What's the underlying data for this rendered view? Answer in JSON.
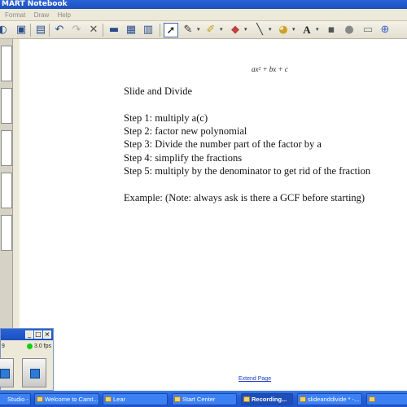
{
  "window": {
    "title": "MART Notebook"
  },
  "menu": {
    "items": [
      "Format",
      "Draw",
      "Help"
    ]
  },
  "page": {
    "formula": "ax² + bx + c",
    "heading": "Slide and Divide",
    "steps": [
      "Step 1: multiply a(c)",
      "Step 2: factor new polynomial",
      "Step 3: Divide the number part of the factor by a",
      "Step 4: simplify the fractions",
      "Step 5: multiply by the denominator to get rid of the fraction"
    ],
    "example": "Example: (Note: always ask is there a GCF before starting)",
    "extend_link": "Extend Page"
  },
  "recorder": {
    "counter": "9",
    "fps": "3.0 fps",
    "status_color": "#11d011"
  },
  "taskbar": {
    "items": [
      "Studio - ...",
      "Welcome to Camt...",
      "Lear",
      "Start Center",
      "Recording...",
      "slideanddivide * -..."
    ],
    "active_index": 4
  },
  "colors": {
    "titlebar": "#2a63d8",
    "taskbar": "#245edb",
    "link": "#1a3cc8"
  },
  "icons": [
    "open-icon",
    "save-icon",
    "paste-icon",
    "undo-icon",
    "redo-icon",
    "delete-icon",
    "screen-shade-icon",
    "capture-icon",
    "table-icon",
    "select-arrow-icon",
    "pen-icon",
    "highlighter-icon",
    "eraser-icon",
    "line-icon",
    "fill-icon",
    "text-icon",
    "properties-icon",
    "move-icon",
    "add-page-icon"
  ]
}
